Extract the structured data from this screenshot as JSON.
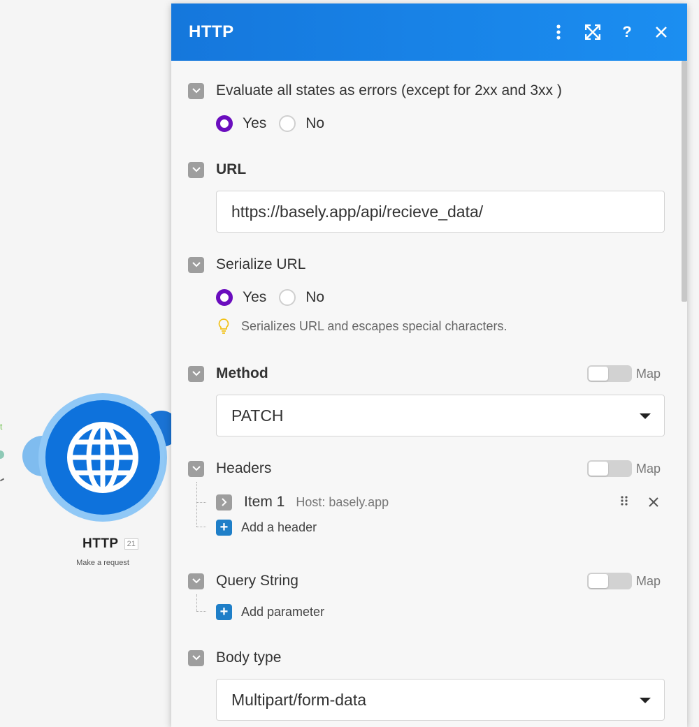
{
  "canvas": {
    "edge_label": "t",
    "module": {
      "title": "HTTP",
      "badge": "21",
      "subtitle": "Make a request",
      "icon": "globe-icon"
    }
  },
  "panel": {
    "title": "HTTP",
    "header_icons": [
      "more-vertical-icon",
      "expand-icon",
      "help-icon",
      "close-icon"
    ],
    "fields": {
      "evaluate_errors": {
        "label": "Evaluate all states as errors (except for 2xx and 3xx )",
        "options": [
          "Yes",
          "No"
        ],
        "selected": "Yes"
      },
      "url": {
        "label": "URL",
        "value": "https://basely.app/api/recieve_data/"
      },
      "serialize_url": {
        "label": "Serialize URL",
        "options": [
          "Yes",
          "No"
        ],
        "selected": "Yes",
        "hint": "Serializes URL and escapes special characters."
      },
      "method": {
        "label": "Method",
        "map_label": "Map",
        "value": "PATCH"
      },
      "headers": {
        "label": "Headers",
        "map_label": "Map",
        "items": [
          {
            "name": "Item 1",
            "value": "Host: basely.app"
          }
        ],
        "add_label": "Add a header"
      },
      "query_string": {
        "label": "Query String",
        "map_label": "Map",
        "add_label": "Add parameter"
      },
      "body_type": {
        "label": "Body type",
        "value": "Multipart/form-data"
      }
    }
  },
  "colors": {
    "header_bg": "#1577dc",
    "radio_selected": "#6a0dbe",
    "node_blue": "#0e72dc",
    "add_button": "#1f7fc8"
  }
}
